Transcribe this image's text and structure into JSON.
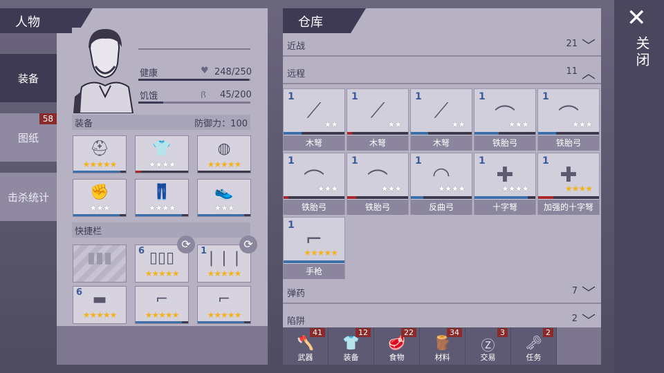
{
  "left_header": "人物",
  "right_header": "仓库",
  "side_tabs": [
    {
      "label": "装备",
      "active": true,
      "badge": ""
    },
    {
      "label": "图纸",
      "active": false,
      "badge": "58"
    },
    {
      "label": "击杀统计",
      "active": false,
      "badge": ""
    }
  ],
  "stats": {
    "health_label": "健康",
    "health_value": "248/250",
    "health_fraction": 0.99,
    "hunger_label": "饥饿",
    "hunger_value": "45/200",
    "hunger_fraction": 0.225
  },
  "equip_section": {
    "title": "装备",
    "defense_label": "防御力：100"
  },
  "quickbar_title": "快捷栏",
  "equip_slots": [
    {
      "icon": "helmet-icon",
      "stars": "★★★★★",
      "star_color": "gold"
    },
    {
      "icon": "shirt-icon",
      "stars": "★★★★",
      "star_color": "white"
    },
    {
      "icon": "armor-icon",
      "stars": "★★★★★",
      "star_color": "gold"
    },
    {
      "icon": "gloves-icon",
      "stars": "★★★",
      "star_color": "white"
    },
    {
      "icon": "pants-icon",
      "stars": "★★★★",
      "star_color": "white"
    },
    {
      "icon": "boots-icon",
      "stars": "★★★",
      "star_color": "white"
    }
  ],
  "quick_slots": [
    {
      "icon": "empty-ammo-slot",
      "count": "",
      "stars": ""
    },
    {
      "icon": "shells-icon",
      "count": "6",
      "stars": "★★★★★"
    },
    {
      "icon": "bullets-icon",
      "count": "1",
      "stars": "★★★★★"
    },
    {
      "icon": "brick-icon",
      "count": "6",
      "stars": "★★★★★"
    },
    {
      "icon": "shotgun-icon",
      "count": "",
      "stars": "★★★★★"
    },
    {
      "icon": "rifle-icon",
      "count": "",
      "stars": "★★★★★"
    }
  ],
  "categories": {
    "melee": {
      "name": "近战",
      "count": "21",
      "chevron": "down"
    },
    "ranged": {
      "name": "远程",
      "count": "11",
      "chevron": "up"
    },
    "ammo": {
      "name": "弹药",
      "count": "7",
      "chevron": "down"
    },
    "traps": {
      "name": "陷阱",
      "count": "2",
      "chevron": "down"
    }
  },
  "ranged_items": [
    {
      "count": "1",
      "label": "木弩",
      "stars": "★★",
      "star_color": "white"
    },
    {
      "count": "1",
      "label": "木弩",
      "stars": "★★",
      "star_color": "white"
    },
    {
      "count": "1",
      "label": "木弩",
      "stars": "★★",
      "star_color": "white"
    },
    {
      "count": "1",
      "label": "铁胎弓",
      "stars": "★★★",
      "star_color": "white"
    },
    {
      "count": "1",
      "label": "铁胎弓",
      "stars": "★★★",
      "star_color": "white"
    },
    {
      "count": "1",
      "label": "铁胎弓",
      "stars": "★★★",
      "star_color": "white"
    },
    {
      "count": "1",
      "label": "铁胎弓",
      "stars": "★★★",
      "star_color": "white"
    },
    {
      "count": "1",
      "label": "反曲弓",
      "stars": "★★★★",
      "star_color": "white"
    },
    {
      "count": "1",
      "label": "十字弩",
      "stars": "★★★★",
      "star_color": "white"
    },
    {
      "count": "1",
      "label": "加强的十字弩",
      "stars": "★★★★",
      "star_color": "gold"
    },
    {
      "count": "1",
      "label": "手枪",
      "stars": "★★★★★",
      "star_color": "gold"
    }
  ],
  "bottom_tabs": [
    {
      "label": "武器",
      "badge": "41",
      "icon": "axe-icon"
    },
    {
      "label": "装备",
      "badge": "12",
      "icon": "shirt-icon"
    },
    {
      "label": "食物",
      "badge": "22",
      "icon": "meat-icon"
    },
    {
      "label": "材料",
      "badge": "34",
      "icon": "wood-icon"
    },
    {
      "label": "交易",
      "badge": "3",
      "icon": "coin-icon"
    },
    {
      "label": "任务",
      "badge": "2",
      "icon": "key-icon"
    }
  ],
  "close_label": "关闭",
  "colors": {
    "accent_dark": "#3f3a53",
    "badge_red": "#8a2a2a",
    "star_gold": "#f3b21b",
    "count_blue": "#3c5b9a"
  }
}
